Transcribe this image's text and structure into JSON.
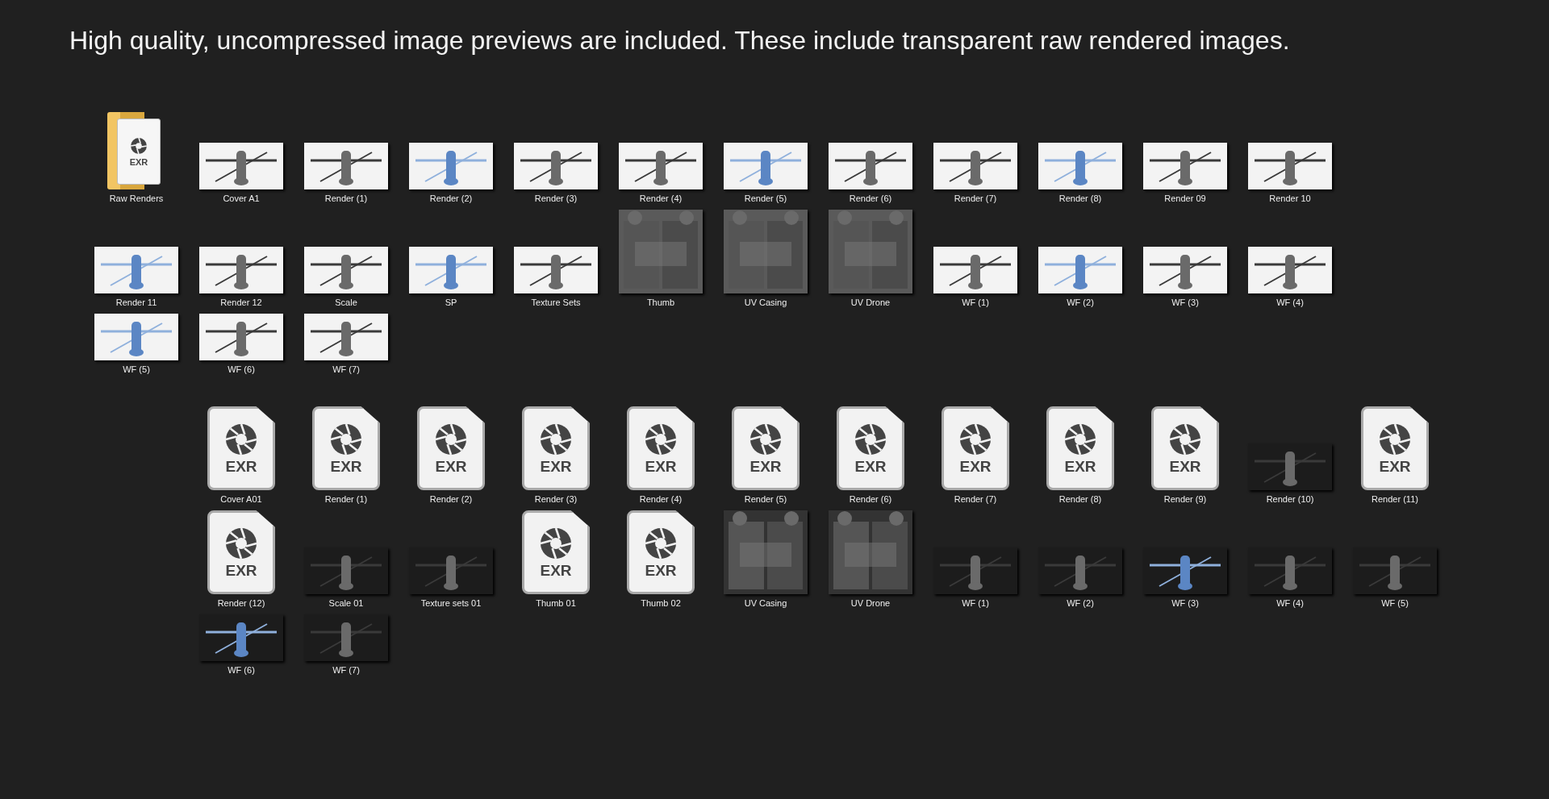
{
  "heading": "High quality, uncompressed image previews are included. These include transparent raw rendered images.",
  "groups": [
    {
      "items": [
        {
          "kind": "folder",
          "label": "Raw Renders",
          "badge": "EXR"
        },
        {
          "kind": "picture",
          "label": "Cover A1"
        },
        {
          "kind": "picture",
          "label": "Render (1)"
        },
        {
          "kind": "picture",
          "label": "Render (2)"
        },
        {
          "kind": "picture",
          "label": "Render (3)"
        },
        {
          "kind": "picture",
          "label": "Render (4)"
        },
        {
          "kind": "picture",
          "label": "Render (5)"
        },
        {
          "kind": "picture",
          "label": "Render (6)"
        },
        {
          "kind": "picture",
          "label": "Render (7)"
        },
        {
          "kind": "picture",
          "label": "Render (8)"
        },
        {
          "kind": "picture",
          "label": "Render 09"
        },
        {
          "kind": "picture",
          "label": "Render 10"
        },
        {
          "kind": "picture",
          "label": "Render 11"
        },
        {
          "kind": "picture",
          "label": "Render 12"
        },
        {
          "kind": "picture",
          "label": "Scale"
        },
        {
          "kind": "picture",
          "label": "SP"
        },
        {
          "kind": "picture",
          "label": "Texture Sets"
        },
        {
          "kind": "square-picture",
          "label": "Thumb"
        },
        {
          "kind": "square-picture",
          "label": "UV Casing"
        },
        {
          "kind": "square-picture",
          "label": "UV Drone"
        },
        {
          "kind": "picture",
          "label": "WF (1)"
        },
        {
          "kind": "picture",
          "label": "WF (2)"
        },
        {
          "kind": "picture",
          "label": "WF (3)"
        },
        {
          "kind": "picture",
          "label": "WF (4)"
        },
        {
          "kind": "picture",
          "label": "WF (5)"
        },
        {
          "kind": "picture",
          "label": "WF (6)"
        },
        {
          "kind": "picture",
          "label": "WF (7)"
        }
      ]
    },
    {
      "items": [
        {
          "kind": "exr",
          "label": "Cover A01",
          "badge": "EXR"
        },
        {
          "kind": "exr",
          "label": "Render (1)",
          "badge": "EXR"
        },
        {
          "kind": "exr",
          "label": "Render (2)",
          "badge": "EXR"
        },
        {
          "kind": "exr",
          "label": "Render (3)",
          "badge": "EXR"
        },
        {
          "kind": "exr",
          "label": "Render (4)",
          "badge": "EXR"
        },
        {
          "kind": "exr",
          "label": "Render (5)",
          "badge": "EXR"
        },
        {
          "kind": "exr",
          "label": "Render (6)",
          "badge": "EXR"
        },
        {
          "kind": "exr",
          "label": "Render (7)",
          "badge": "EXR"
        },
        {
          "kind": "exr",
          "label": "Render (8)",
          "badge": "EXR"
        },
        {
          "kind": "exr",
          "label": "Render (9)",
          "badge": "EXR"
        },
        {
          "kind": "picture",
          "label": "Render (10)"
        },
        {
          "kind": "exr",
          "label": "Render (11)",
          "badge": "EXR"
        },
        {
          "kind": "exr",
          "label": "Render (12)",
          "badge": "EXR"
        },
        {
          "kind": "picture",
          "label": "Scale 01"
        },
        {
          "kind": "picture",
          "label": "Texture sets 01"
        },
        {
          "kind": "exr",
          "label": "Thumb 01",
          "badge": "EXR"
        },
        {
          "kind": "exr",
          "label": "Thumb 02",
          "badge": "EXR"
        },
        {
          "kind": "square-picture",
          "label": "UV Casing"
        },
        {
          "kind": "square-picture",
          "label": "UV Drone"
        },
        {
          "kind": "picture",
          "label": "WF (1)"
        },
        {
          "kind": "picture",
          "label": "WF (2)"
        },
        {
          "kind": "picture",
          "label": "WF (3)"
        },
        {
          "kind": "picture",
          "label": "WF (4)"
        },
        {
          "kind": "picture",
          "label": "WF (5)"
        },
        {
          "kind": "picture",
          "label": "WF (6)"
        },
        {
          "kind": "picture",
          "label": "WF (7)"
        }
      ]
    }
  ]
}
